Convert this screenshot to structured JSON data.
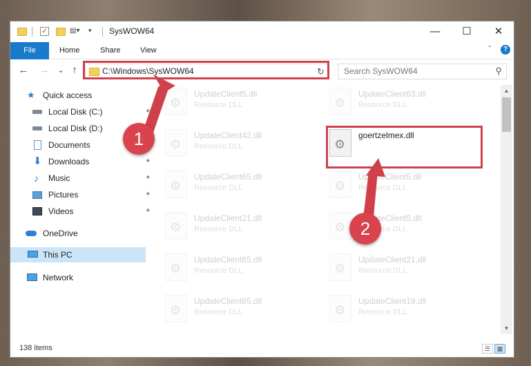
{
  "window": {
    "title": "SysWOW64",
    "minimize": "—",
    "maximize": "☐",
    "close": "✕"
  },
  "ribbon": {
    "tabs": [
      {
        "label": "File"
      },
      {
        "label": "Home"
      },
      {
        "label": "Share"
      },
      {
        "label": "View"
      }
    ],
    "help": "?",
    "collapse": "⌃"
  },
  "navigation": {
    "back": "←",
    "forward": "→",
    "recent": "⌄",
    "up": "↑",
    "address": "C:\\Windows\\SysWOW64",
    "address_dropdown": "⌄",
    "refresh": "↻",
    "search_placeholder": "Search SysWOW64",
    "search_icon": "⚲"
  },
  "sidebar": {
    "items": [
      {
        "label": "Quick access",
        "icon": "star-icon",
        "pinned": false
      },
      {
        "label": "Local Disk (C:)",
        "icon": "drive-icon",
        "pinned": true
      },
      {
        "label": "Local Disk (D:)",
        "icon": "drive-icon",
        "pinned": false
      },
      {
        "label": "Documents",
        "icon": "documents-icon",
        "pinned": false
      },
      {
        "label": "Downloads",
        "icon": "download-icon",
        "pinned": true
      },
      {
        "label": "Music",
        "icon": "music-icon",
        "pinned": true
      },
      {
        "label": "Pictures",
        "icon": "pictures-icon",
        "pinned": true
      },
      {
        "label": "Videos",
        "icon": "videos-icon",
        "pinned": true
      },
      {
        "label": "OneDrive",
        "icon": "onedrive-icon",
        "pinned": false
      },
      {
        "label": "This PC",
        "icon": "pc-icon",
        "pinned": false,
        "selected": true
      },
      {
        "label": "Network",
        "icon": "network-icon",
        "pinned": false
      }
    ],
    "pin_glyph": "📌"
  },
  "files": {
    "left": [
      {
        "name": "UpdateClient5.dll",
        "type": "Resource DLL"
      },
      {
        "name": "UpdateClient42.dll",
        "type": "Resource DLL"
      },
      {
        "name": "UpdateClient65.dll",
        "type": "Resource DLL"
      },
      {
        "name": "UpdateClient21.dll",
        "type": "Resource DLL"
      },
      {
        "name": "UpdateClient65.dll",
        "type": "Resource DLL"
      },
      {
        "name": "UpdateClient65.dll",
        "type": "Resource DLL"
      }
    ],
    "right": [
      {
        "name": "UpdateClient63.dll",
        "type": "Resource DLL"
      },
      {
        "name": "goertzelmex.dll",
        "type": ""
      },
      {
        "name": "UpdateClient5.dll",
        "type": "Resource DLL"
      },
      {
        "name": "UpdateClient5.dll",
        "type": "Resource DLL"
      },
      {
        "name": "UpdateClient21.dll",
        "type": "Resource DLL"
      },
      {
        "name": "UpdateClient19.dll",
        "type": "Resource DLL"
      }
    ],
    "gear_glyph": "⚙"
  },
  "status": {
    "item_count": "138 items"
  },
  "annotations": {
    "step1": "1",
    "step2": "2",
    "color": "#d0404b"
  }
}
